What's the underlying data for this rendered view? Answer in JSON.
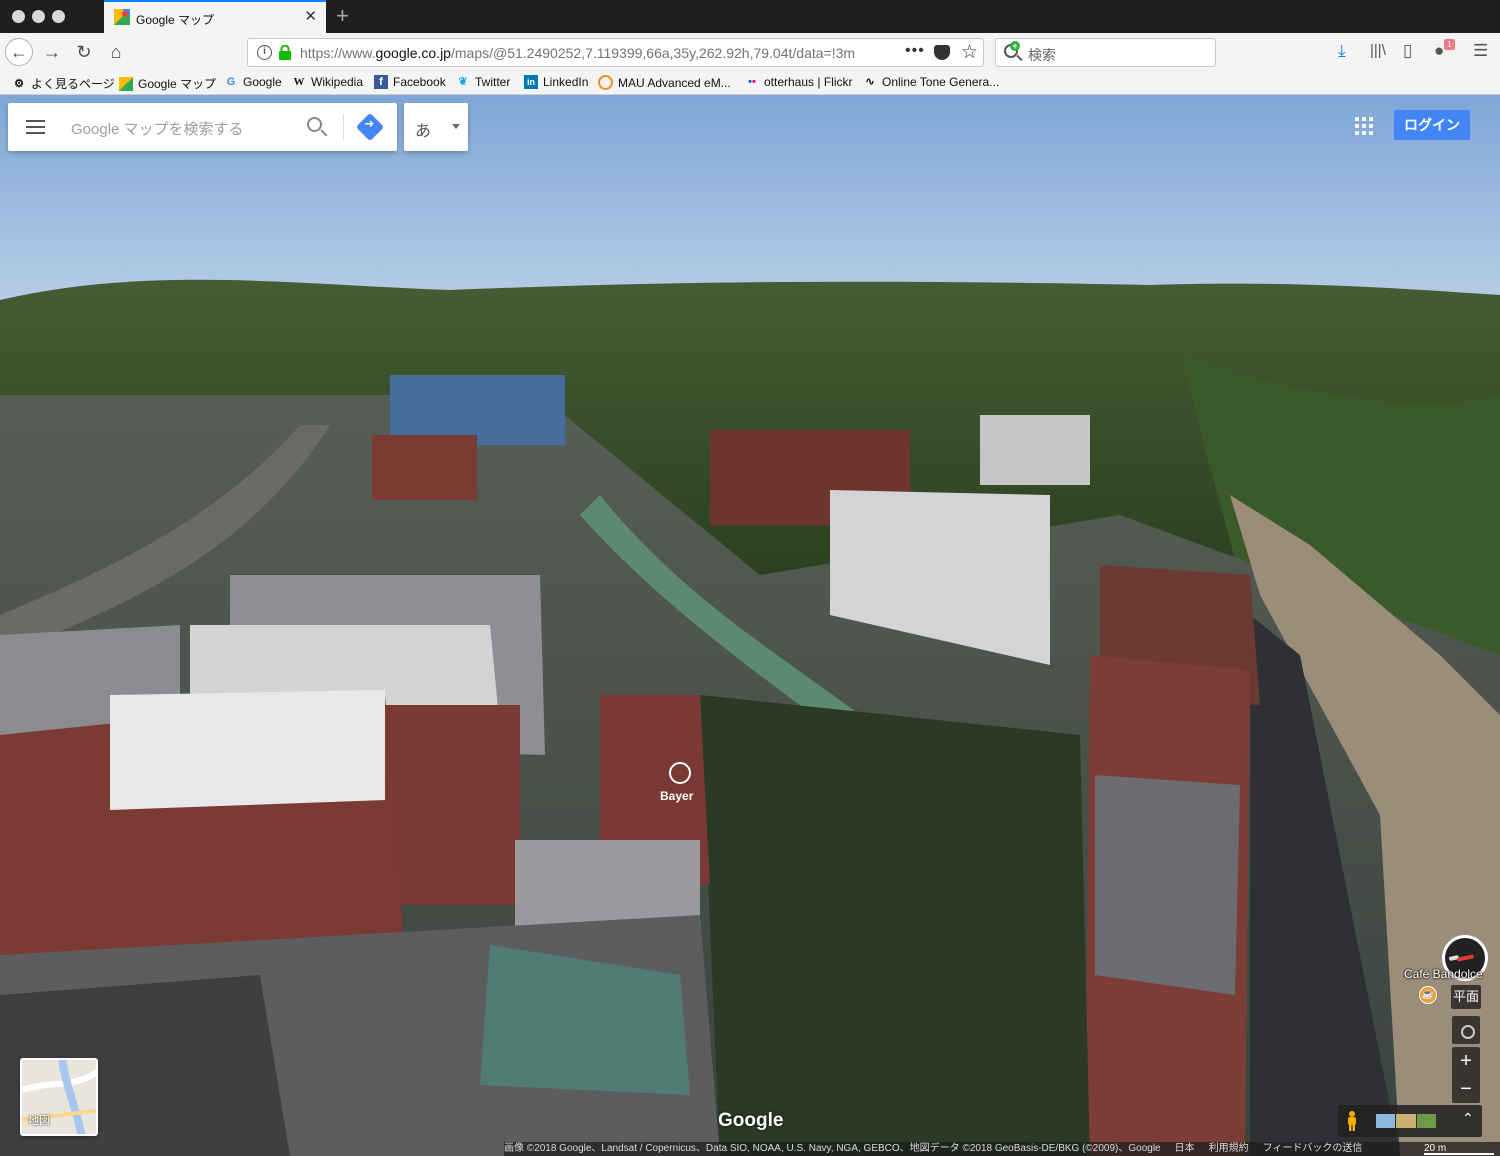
{
  "browser": {
    "tab_title": "Google マップ",
    "url_prefix": "https://www.",
    "url_host": "google.co.jp",
    "url_rest": "/maps/@51.2490252,7.119399,66a,35y,262.92h,79.04t/data=!3m",
    "search_placeholder": "検索",
    "download_badge": "1"
  },
  "bookmarks": [
    {
      "label": "よく見るページ",
      "icon": "gear-icon"
    },
    {
      "label": "Google マップ",
      "icon": "maps-icon"
    },
    {
      "label": "Google",
      "icon": "google-icon"
    },
    {
      "label": "Wikipedia",
      "icon": "wikipedia-icon"
    },
    {
      "label": "Facebook",
      "icon": "facebook-icon"
    },
    {
      "label": "Twitter",
      "icon": "twitter-icon"
    },
    {
      "label": "LinkedIn",
      "icon": "linkedin-icon"
    },
    {
      "label": "MAU Advanced eM...",
      "icon": "ring-icon"
    },
    {
      "label": "otterhaus | Flickr",
      "icon": "flickr-icon"
    },
    {
      "label": "Online Tone Genera...",
      "icon": "wave-icon"
    }
  ],
  "maps": {
    "search_placeholder": "Google マップを検索する",
    "ime_label": "あ",
    "login_label": "ログイン",
    "layer_label": "地図",
    "watermark": "Google",
    "building_label": "Bayer",
    "place_label": "Café Bandolce",
    "tilt_label": "平面",
    "zoom_in": "+",
    "zoom_out": "−",
    "expand": "⌃",
    "attribution": [
      "画像 ©2018 Google、Landsat / Copernicus、Data SIO, NOAA, U.S. Navy, NGA, GEBCO、地図データ ©2018 GeoBasis-DE/BKG (©2009)、Google",
      "日本",
      "利用規約",
      "フィードバックの送信"
    ],
    "scale": "20 m"
  },
  "colors": {
    "accent": "#4285f4",
    "tab_highlight": "#0a84ff",
    "sky": "#8fb2dc",
    "forest": "#2f4a23"
  }
}
